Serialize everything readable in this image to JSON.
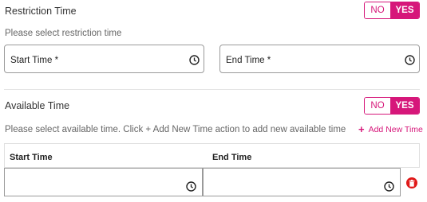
{
  "restriction": {
    "title": "Restriction Time",
    "toggle_no": "NO",
    "toggle_yes": "YES",
    "selected": "YES",
    "hint": "Please select restriction time",
    "start_label": "Start Time *",
    "end_label": "End Time *"
  },
  "available": {
    "title": "Available Time",
    "toggle_no": "NO",
    "toggle_yes": "YES",
    "selected": "YES",
    "hint": "Please select available time. Click + Add New Time action to add new available time",
    "add_label": "Add New Time",
    "columns": [
      "Start Time",
      "End Time"
    ]
  },
  "colors": {
    "accent": "#d6177a",
    "danger": "#e01a1a"
  },
  "icons": {
    "time": "clock-icon",
    "delete": "trash-icon",
    "add": "plus-icon"
  }
}
